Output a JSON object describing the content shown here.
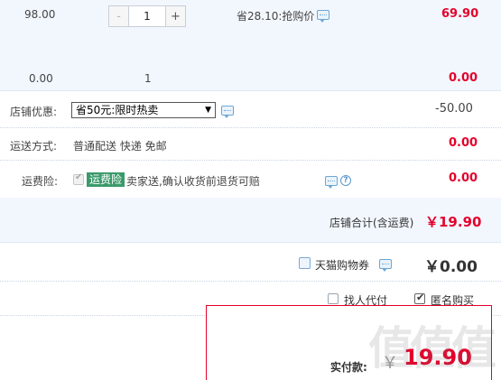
{
  "item": {
    "unit_price": "98.00",
    "quantity": "1",
    "minus": "-",
    "plus": "+",
    "promo_text": "省28.10:抢购价",
    "subtotal": "69.90"
  },
  "summary_row": {
    "price": "0.00",
    "quantity": "1",
    "total": "0.00"
  },
  "shop_discount": {
    "label": "店铺优惠:",
    "selected_option": "省50元:限时热卖",
    "amount": "-50.00"
  },
  "shipping": {
    "label": "运送方式:",
    "method": "普通配送 快递 免邮",
    "amount": "0.00"
  },
  "shipping_insurance": {
    "label": "运费险:",
    "tag": "运费险",
    "description": "卖家送,确认收货前退货可赔",
    "amount": "0.00"
  },
  "shop_total": {
    "label": "店铺合计(含运费)",
    "amount": "￥19.90"
  },
  "coupon": {
    "label": "天猫购物券",
    "amount": "￥0.00"
  },
  "options": {
    "proxy_pay": "找人代付",
    "anonymous": "匿名购买"
  },
  "payment": {
    "label": "实付款:",
    "currency": "￥",
    "amount": "19.90"
  },
  "colors": {
    "accent_red": "#e4002b",
    "row_band": "#f2f7fe",
    "tag_green": "#3a9a6a"
  }
}
